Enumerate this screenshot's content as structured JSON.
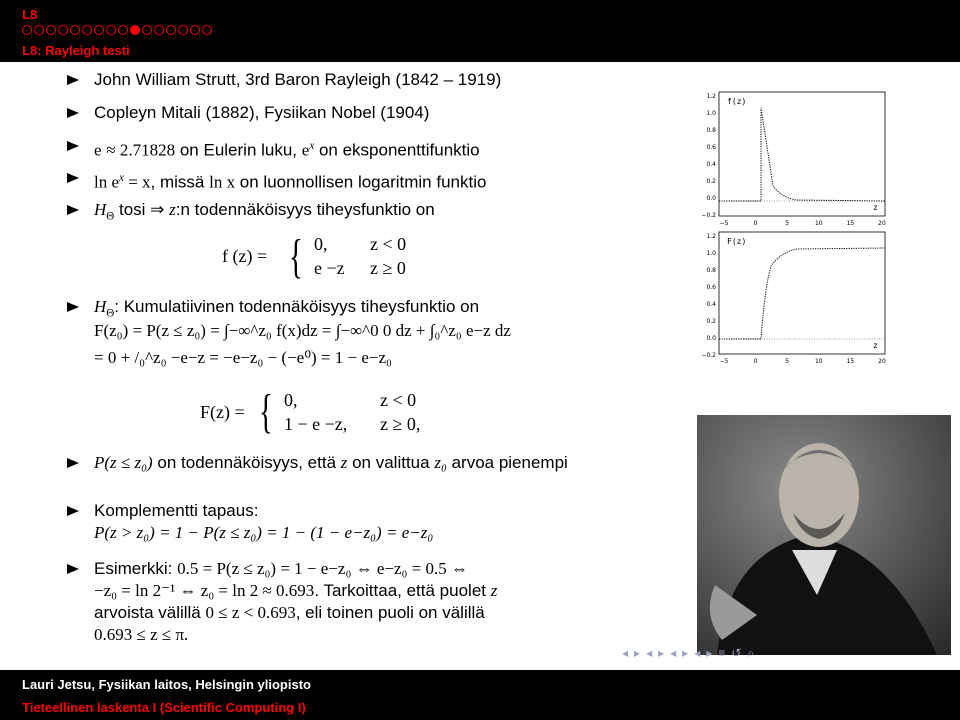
{
  "header": {
    "section": "L8",
    "subsection": "L8: Rayleigh testi",
    "dots_filled": [
      false,
      false,
      false,
      false,
      false,
      false,
      false,
      false,
      false,
      true,
      false,
      false,
      false,
      false,
      false,
      false
    ]
  },
  "bullets": {
    "b1": "John William Strutt, 3rd Baron Rayleigh (1842 – 1919)",
    "b2": "Copleyn Mitali (1882), Fysiikan Nobel (1904)",
    "b3_a": "e",
    "b3_b": "≈ 2.71828",
    "b3_c": " on Eulerin luku, ",
    "b3_d": "e",
    "b3_e": "x",
    "b3_f": " on eksponenttifunktio",
    "b4_a": "ln e",
    "b4_b": "x",
    "b4_c": " = x",
    "b4_d": ", missä ",
    "b4_e": "ln x",
    "b4_f": " on luonnollisen logaritmin funktio",
    "b5_a": "H",
    "b5_b": "Θ",
    "b5_c": " tosi ⇒ ",
    "b5_d": "z",
    "b5_e": ":n todennäköisyys tiheysfunktio on",
    "b6_a": "H",
    "b6_b": "Θ",
    "b6_c": ": Kumulatiivinen todennäköisyys tiheysfunktio on",
    "b7": "P(z ≤ z₀)",
    "b7_text": " on todennäköisyys, että ",
    "b7_z": "z",
    "b7_text2": " on valittua ",
    "b7_z0": "z₀",
    "b7_text3": " arvoa pienempi",
    "b8_title": "Komplementti tapaus:",
    "b9_title": "Esimerkki: ",
    "b9_c": ". Tarkoittaa, että puolet ",
    "b9_d": "z",
    "b9_e": "arvoista välillä ",
    "b9_g": ", eli toinen puoli on välillä"
  },
  "math": {
    "fz_lhs": "f (z) =",
    "fz_c1": "0,",
    "fz_c1c": "z < 0",
    "fz_c2": "e −z",
    "fz_c2c": "z ≥ 0",
    "F_line1": "F(z₀) = P(z ≤ z₀) = ∫−∞^z₀ f(x)dz = ∫−∞^0 0 dz + ∫₀^z₀ e−z dz",
    "F_line2": "= 0 + /₀^z₀ −e−z = −e−z₀ − (−e⁰) = 1 − e−z₀",
    "Fz_lhs": "F(z) =",
    "Fz_c1": "0,",
    "Fz_c1c": "z < 0",
    "Fz_c2": "1 − e −z,",
    "Fz_c2c": "z ≥ 0,",
    "comp": "P(z > z₀) = 1 − P(z ≤ z₀) = 1 − (1 − e−z₀) = e−z₀",
    "ex1": "0.5 = P(z ≤ z₀) = 1 − e−z₀ ⇔ e−z₀ = 0.5 ⇔",
    "ex2": "−z₀ = ln 2⁻¹ ⇔ z₀ = ln 2 ≈ 0.693",
    "ex3": "0 ≤ z < 0.693",
    "ex4": "0.693 ≤ z ≤ π."
  },
  "fig_top": {
    "label": "f(z)",
    "xlabel": "z",
    "yticks": [
      "1.2",
      "1.0",
      "0.8",
      "0.6",
      "0.4",
      "0.2",
      "0.0",
      "−0.2"
    ],
    "xticks": [
      "−5",
      "0",
      "5",
      "10",
      "15",
      "20"
    ]
  },
  "fig_bottom": {
    "label": "F(z)",
    "xlabel": "z",
    "yticks": [
      "1.2",
      "1.0",
      "0.8",
      "0.6",
      "0.4",
      "0.2",
      "0.0",
      "−0.2"
    ],
    "xticks": [
      "−5",
      "0",
      "5",
      "10",
      "15",
      "20"
    ]
  },
  "nav_icons": [
    "◂",
    "▸",
    "◂",
    "▸",
    "◂",
    "▸",
    "◂",
    "▸",
    "≡",
    "↺",
    "⌕"
  ],
  "footer": {
    "author": "Lauri Jetsu, Fysiikan laitos, Helsingin yliopisto",
    "course": "Tieteellinen laskenta I (Scientific Computing I)"
  }
}
